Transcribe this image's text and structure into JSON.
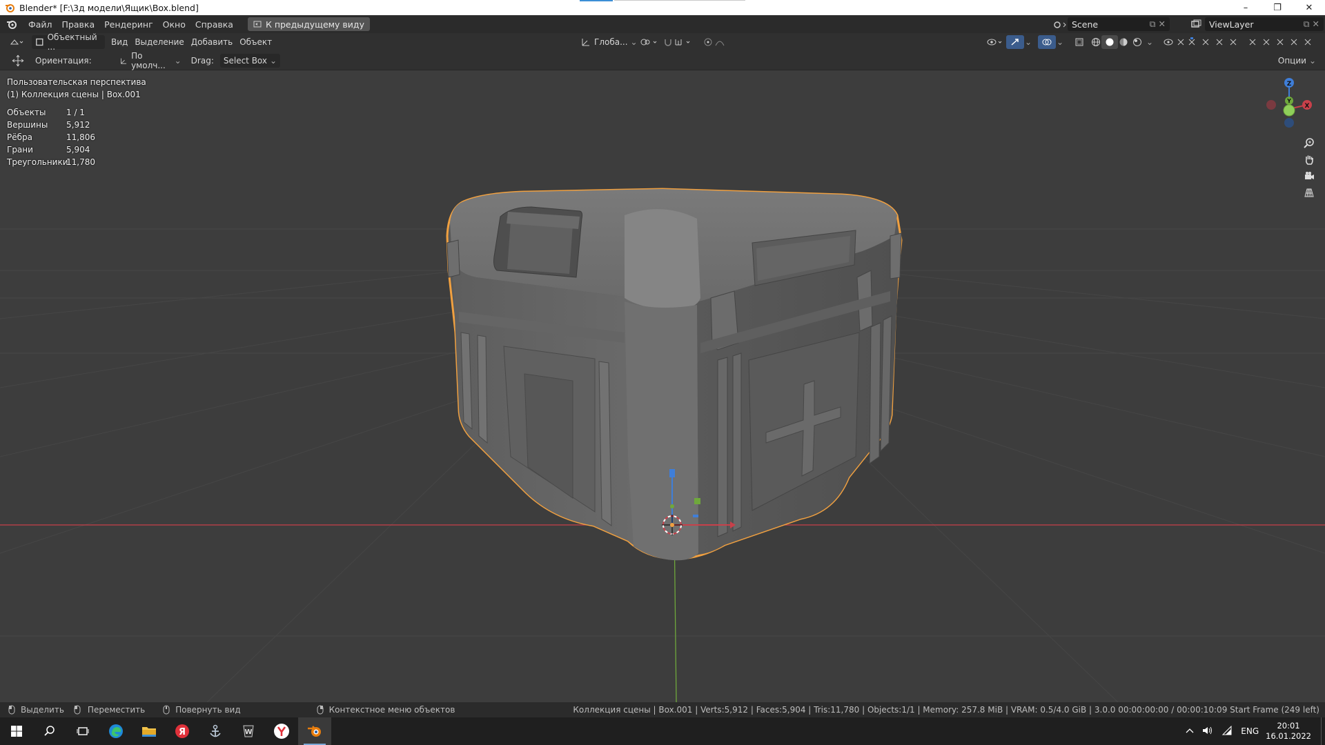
{
  "window": {
    "title": "Blender* [F:\\3д модели\\Ящик\\Box.blend]",
    "controls": [
      "–",
      "❐",
      "✕"
    ]
  },
  "menubar": {
    "items": [
      "Файл",
      "Правка",
      "Рендеринг",
      "Окно",
      "Справка"
    ],
    "back_button": "К предыдущему виду",
    "scene": "Scene",
    "view_layer": "ViewLayer"
  },
  "header": {
    "mode": "Объектный ...",
    "menus": [
      "Вид",
      "Выделение",
      "Добавить",
      "Объект"
    ],
    "transform_orientation": "Глоба...",
    "options": "Опции"
  },
  "toolsettings": {
    "orientation_label": "Ориентация:",
    "orientation_value": "По умолч...",
    "drag_label": "Drag:",
    "drag_value": "Select Box"
  },
  "viewport": {
    "view_name": "Пользовательская перспектива",
    "collection": "(1) Коллекция сцены | Box.001",
    "stats": [
      {
        "label": "Объекты",
        "value": "1 / 1"
      },
      {
        "label": "Вершины",
        "value": "5,912"
      },
      {
        "label": "Рёбра",
        "value": "11,806"
      },
      {
        "label": "Грани",
        "value": "5,904"
      },
      {
        "label": "Треугольники",
        "value": "11,780"
      }
    ],
    "gizmo_axes": [
      "Z",
      "Y",
      "X"
    ]
  },
  "statusbar": {
    "hints": [
      "Выделить",
      "Переместить",
      "Повернуть вид",
      "Контекстное меню объектов"
    ],
    "info": "Коллекция сцены | Box.001 | Verts:5,912 | Faces:5,904 | Tris:11,780 | Objects:1/1 | Memory: 257.8 MiB | VRAM: 0.5/4.0 GiB | 3.0.0   00:00:00:00 / 00:00:10:09  Start Frame (249 left)"
  },
  "taskbar": {
    "language": "ENG",
    "time": "20:01",
    "date": "16.01.2022"
  },
  "colors": {
    "selection_outline": "#f0a040",
    "x_axis": "#c8404a",
    "y_axis": "#6fa83c",
    "z_axis": "#3f7ed8"
  }
}
